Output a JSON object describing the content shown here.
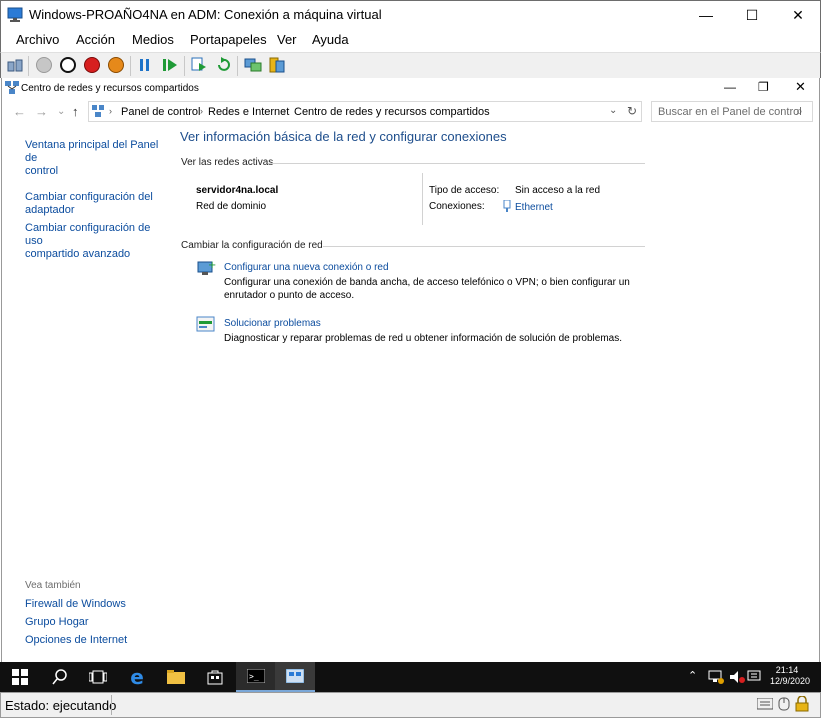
{
  "vm_window": {
    "title": "Windows-PROAÑO4NA en ADM: Conexión a máquina virtual",
    "controls": {
      "minimize": "—",
      "maximize": "☐",
      "close": "✕"
    }
  },
  "menu": [
    "Archivo",
    "Acción",
    "Medios",
    "Portapapeles",
    "Ver",
    "Ayuda"
  ],
  "explorer": {
    "title": "Centro de redes y recursos compartidos",
    "breadcrumb": [
      "Panel de control",
      "Redes e Internet",
      "Centro de redes y recursos compartidos"
    ],
    "search_placeholder": "Buscar en el Panel de control"
  },
  "sidebar": {
    "links": [
      {
        "line1": "Ventana principal del Panel de",
        "line2": "control"
      },
      {
        "line1": "Cambiar configuración del",
        "line2": "adaptador"
      },
      {
        "line1": "Cambiar configuración de uso",
        "line2": "compartido avanzado"
      }
    ],
    "see_also": "Vea también",
    "see_also_links": [
      "Firewall de Windows",
      "Grupo Hogar",
      "Opciones de Internet"
    ]
  },
  "main": {
    "heading": "Ver información básica de la red y configurar conexiones",
    "active_networks_label": "Ver las redes activas",
    "network": {
      "name": "servidor4na.local",
      "type": "Red de dominio",
      "access_label": "Tipo de acceso:",
      "access_value": "Sin acceso a la red",
      "connections_label": "Conexiones:",
      "connections_value": "Ethernet"
    },
    "change_label": "Cambiar la configuración de red",
    "tasks": [
      {
        "title": "Configurar una nueva conexión o red",
        "desc1": "Configurar una conexión de banda ancha, de acceso telefónico o VPN; o bien configurar un",
        "desc2": "enrutador o punto de acceso."
      },
      {
        "title": "Solucionar problemas",
        "desc1": "Diagnosticar y reparar problemas de red u obtener información de solución de problemas."
      }
    ]
  },
  "taskbar": {
    "time": "21:14",
    "date": "12/9/2020"
  },
  "status": {
    "text": "Estado: ejecutando"
  },
  "colors": {
    "link": "#0b4c9e",
    "heading": "#1e4e8c",
    "taskbar": "#101010"
  }
}
